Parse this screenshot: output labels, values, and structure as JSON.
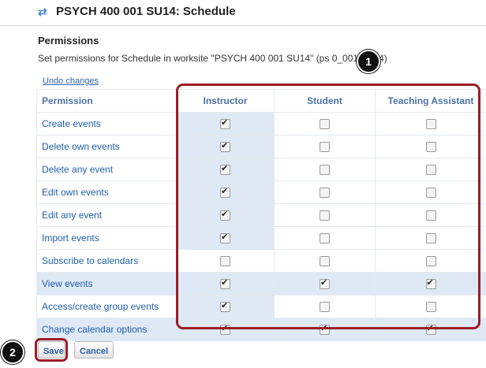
{
  "header": {
    "title": "PSYCH 400 001 SU14: Schedule",
    "icon": "refresh-arrows-icon"
  },
  "permissions": {
    "heading": "Permissions",
    "description": "Set permissions for Schedule in worksite \"PSYCH 400 001 SU14\" (ps          0_001_su14)",
    "undo_label": "Undo changes"
  },
  "table": {
    "headers": [
      "Permission",
      "Instructor",
      "Student",
      "Teaching Assistant"
    ],
    "rows": [
      {
        "label": "Create events",
        "instructor": true,
        "student": false,
        "ta": false
      },
      {
        "label": "Delete own events",
        "instructor": true,
        "student": false,
        "ta": false
      },
      {
        "label": "Delete any event",
        "instructor": true,
        "student": false,
        "ta": false
      },
      {
        "label": "Edit own events",
        "instructor": true,
        "student": false,
        "ta": false
      },
      {
        "label": "Edit any event",
        "instructor": true,
        "student": false,
        "ta": false
      },
      {
        "label": "Import events",
        "instructor": true,
        "student": false,
        "ta": false
      },
      {
        "label": "Subscribe to calendars",
        "instructor": false,
        "student": false,
        "ta": false
      },
      {
        "label": "View events",
        "instructor": true,
        "student": true,
        "ta": true
      },
      {
        "label": "Access/create group events",
        "instructor": true,
        "student": false,
        "ta": false
      },
      {
        "label": "Change calendar options",
        "instructor": true,
        "student": true,
        "ta": true
      }
    ]
  },
  "markers": [
    "1",
    "2"
  ],
  "buttons": {
    "save": "Save",
    "cancel": "Cancel"
  },
  "colors": {
    "highlight": "#9b1d26",
    "link": "#1e5fa9",
    "header": "#4b73a5",
    "shade": "#dfe9f6"
  }
}
